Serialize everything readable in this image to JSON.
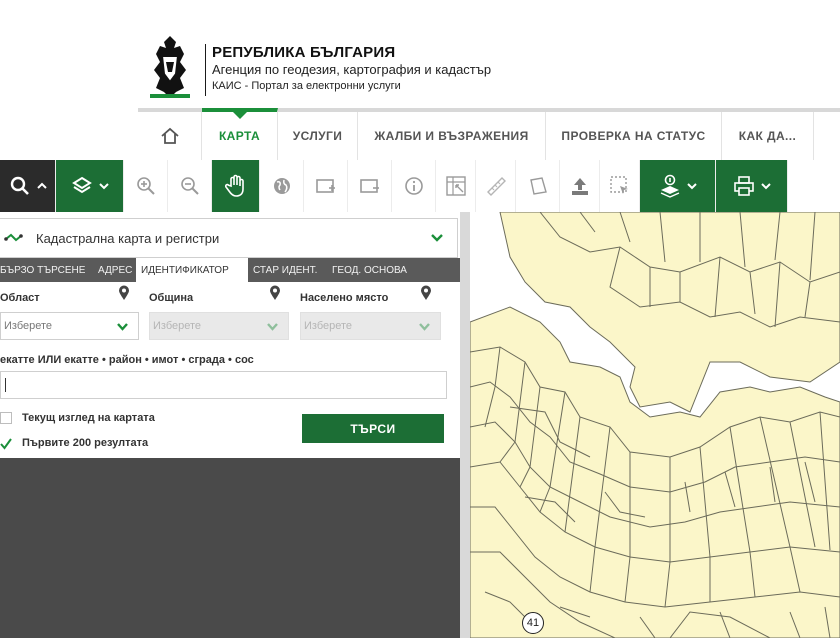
{
  "header": {
    "org_title": "РЕПУБЛИКА БЪЛГАРИЯ",
    "org_subtitle": "Агенция по геодезия, картография и кадастър",
    "portal": "КАИС - Портал за електронни услуги"
  },
  "nav": {
    "items": [
      {
        "label": "КАРТА",
        "active": true
      },
      {
        "label": "УСЛУГИ"
      },
      {
        "label": "ЖАЛБИ И ВЪЗРАЖЕНИЯ"
      },
      {
        "label": "ПРОВЕРКА НА СТАТУС"
      },
      {
        "label": "КАК ДА..."
      }
    ],
    "icons": {
      "home": "home-icon"
    }
  },
  "toolbar": {
    "icons": [
      "search-icon",
      "layers-icon",
      "zoom-in-icon",
      "zoom-out-icon",
      "pan-hand-icon",
      "globe-icon",
      "select-add-icon",
      "select-remove-icon",
      "info-icon",
      "table-icon",
      "measure-ruler-icon",
      "polygon-icon",
      "upload-icon",
      "select-area-icon",
      "download-layer-icon",
      "print-icon"
    ]
  },
  "panel": {
    "layer_select": "Кадастрална карта и регистри",
    "tabs": [
      {
        "label": "БЪРЗО ТЪРСЕНЕ"
      },
      {
        "label": "АДРЕС"
      },
      {
        "label": "ИДЕНТИФИКАТОР",
        "active": true
      },
      {
        "label": "СТАР ИДЕНТ."
      },
      {
        "label": "ГЕОД. ОСНОВА"
      }
    ],
    "fields": {
      "oblast": {
        "label": "Област",
        "placeholder": "Изберете"
      },
      "obshtina": {
        "label": "Община",
        "placeholder": "Изберете"
      },
      "naseleno": {
        "label": "Населено място",
        "placeholder": "Изберете"
      }
    },
    "ekatte_label": "екатте ИЛИ екатте • район • имот • сграда • сос",
    "ekatte_value": "",
    "checkbox_current_view": {
      "label": "Текущ изглед на картата",
      "checked": false
    },
    "checkbox_first_200": {
      "label": "Първите 200 резултата",
      "checked": true
    },
    "search_button": "ТЪРСИ"
  },
  "map": {
    "badge": "41",
    "colors": {
      "parcel_fill": "#fbf6c9",
      "parcel_line": "#6b6b5a"
    }
  },
  "colors": {
    "accent_green": "#1b8f3a",
    "toolbar_green": "#1c6e35",
    "toolbar_dark": "#2b2b2b"
  }
}
